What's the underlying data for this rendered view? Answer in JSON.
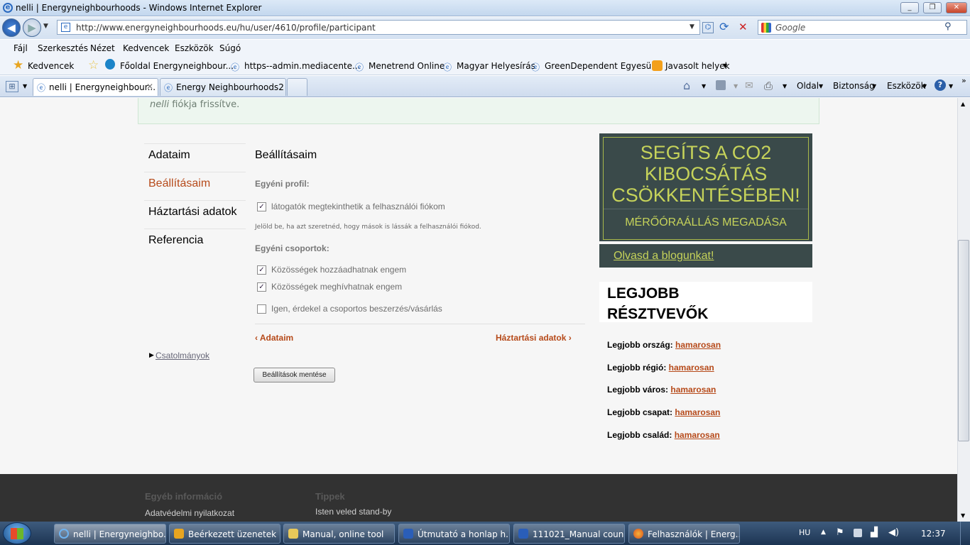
{
  "window": {
    "title": "nelli | Energyneighbourhoods - Windows Internet Explorer"
  },
  "nav": {
    "url": "http://www.energyneighbourhoods.eu/hu/user/4610/profile/participant",
    "search_placeholder": "Google"
  },
  "menu": [
    "Fájl",
    "Szerkesztés",
    "Nézet",
    "Kedvencek",
    "Eszközök",
    "Súgó"
  ],
  "favorites": {
    "label": "Kedvencek",
    "items": [
      "Főoldal Energyneighbour...",
      "https--admin.mediacente...",
      "Menetrend Online",
      "Magyar Helyesírás",
      "GreenDependent Egyesület",
      "Javasolt helyek"
    ]
  },
  "tabs": [
    "nelli | Energyneighbour...",
    "Energy Neighbourhoods2 ..."
  ],
  "commands": [
    "Oldal",
    "Biztonság",
    "Eszközök"
  ],
  "page": {
    "message_user": "nelli",
    "message_text": " fiókja frissítve.",
    "sidebar": [
      "Adataim",
      "Beállításaim",
      "Háztartási adatok",
      "Referencia"
    ],
    "attachments": "Csatolmányok",
    "heading": "Beállításaim",
    "profile_section": "Egyéni profil:",
    "profile_checkbox": "látogatók megtekinthetik a felhasználói fiókom",
    "profile_hint": "Jelöld be, ha azt szeretnéd, hogy mások is lássák a felhasználói fiókod.",
    "groups_section": "Egyéni csoportok:",
    "group_checks": [
      {
        "label": "Közösségek hozzáadhatnak engem",
        "checked": true
      },
      {
        "label": "Közösségek meghívhatnak engem",
        "checked": true
      },
      {
        "label": "Igen, érdekel a csoportos beszerzés/vásárlás",
        "checked": false
      }
    ],
    "prev_link": "‹ Adataim",
    "next_link": "Háztartási adatok ›",
    "save_button": "Beállítások mentése",
    "co2_banner": "SEGÍTS A CO2 KIBOCSÁTÁS CSÖKKENTÉSÉBEN!",
    "co2_link": "MÉRŐÓRAÁLLÁS MEGADÁSA",
    "blog_link": "Olvasd a blogunkat!",
    "best_title": "LEGJOBB RÉSZTVEVŐK",
    "best_rows": [
      {
        "label": "Legjobb ország:",
        "value": "hamarosan"
      },
      {
        "label": "Legjobb régió:",
        "value": "hamarosan"
      },
      {
        "label": "Legjobb város:",
        "value": "hamarosan"
      },
      {
        "label": "Legjobb csapat:",
        "value": "hamarosan"
      },
      {
        "label": "Legjobb család:",
        "value": "hamarosan"
      }
    ],
    "footer": {
      "col1_title": "Egyéb információ",
      "col1_item": "Adatvédelmi nyilatkozat",
      "col2_title": "Tippek",
      "col2_item": "Isten veled stand-by"
    }
  },
  "taskbar": {
    "items": [
      "nelli | Energyneighbo...",
      "Beérkezett üzenetek ...",
      "Manual, online tool",
      "Útmutató a honlap h...",
      "111021_Manual coun...",
      "Felhasználók | Energ..."
    ],
    "lang": "HU",
    "clock": "12:37"
  },
  "colors": {
    "accent": "#b64a1a",
    "banner_bg": "#3a4a4a",
    "banner_text": "#c6d35a"
  }
}
